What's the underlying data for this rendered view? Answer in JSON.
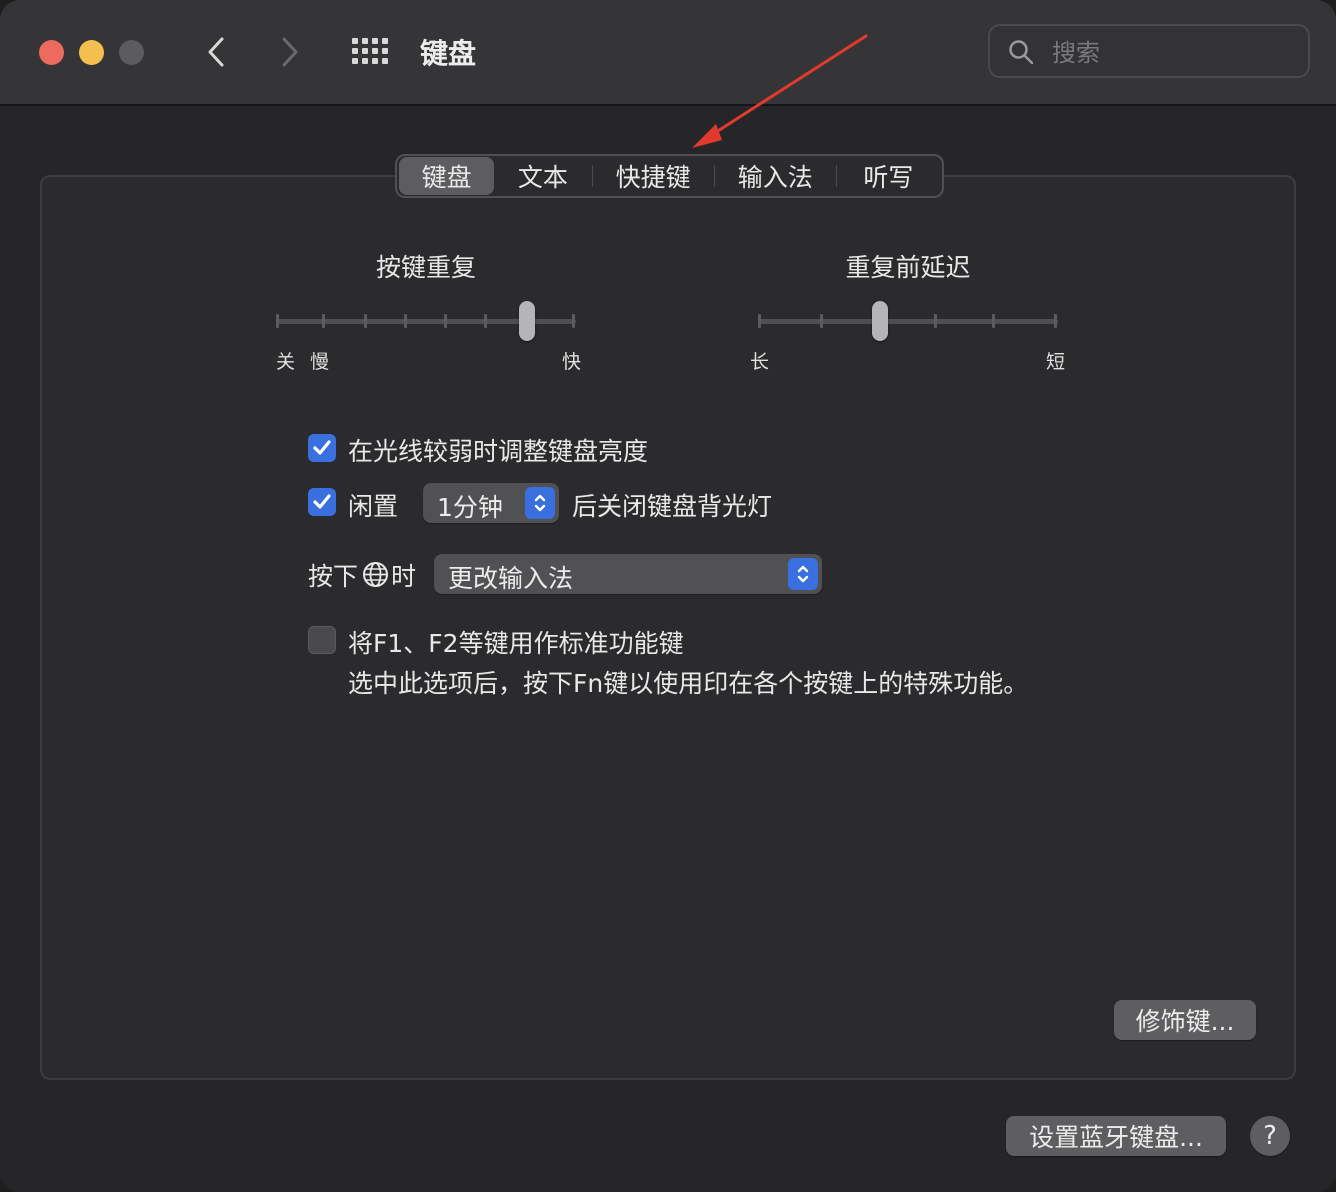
{
  "window": {
    "title": "键盘",
    "search_placeholder": "搜索"
  },
  "tabs": [
    {
      "label": "键盘",
      "active": true
    },
    {
      "label": "文本",
      "active": false
    },
    {
      "label": "快捷键",
      "active": false
    },
    {
      "label": "输入法",
      "active": false
    },
    {
      "label": "听写",
      "active": false
    }
  ],
  "key_repeat": {
    "title": "按键重复",
    "label_off": "关",
    "label_slow": "慢",
    "label_fast": "快",
    "position": 0.84
  },
  "delay_until_repeat": {
    "title": "重复前延迟",
    "label_long": "长",
    "label_short": "短",
    "position": 0.4
  },
  "options": {
    "adjust_brightness": {
      "label": "在光线较弱时调整键盘亮度",
      "checked": true
    },
    "backlight_off": {
      "prefix": "闲置",
      "value": "1分钟",
      "suffix": "后关闭键盘背光灯",
      "checked": true
    },
    "globe_key": {
      "prefix": "按下",
      "suffix": "时",
      "value": "更改输入法"
    },
    "fn_keys": {
      "label": "将F1、F2等键用作标准功能键",
      "description": "选中此选项后，按下Fn键以使用印在各个按键上的特殊功能。",
      "checked": false
    }
  },
  "buttons": {
    "modifier_keys": "修饰键...",
    "bluetooth_keyboard": "设置蓝牙键盘...",
    "help": "?"
  },
  "colors": {
    "accent": "#3a6fe0",
    "annotation_arrow": "#e03a2f"
  }
}
